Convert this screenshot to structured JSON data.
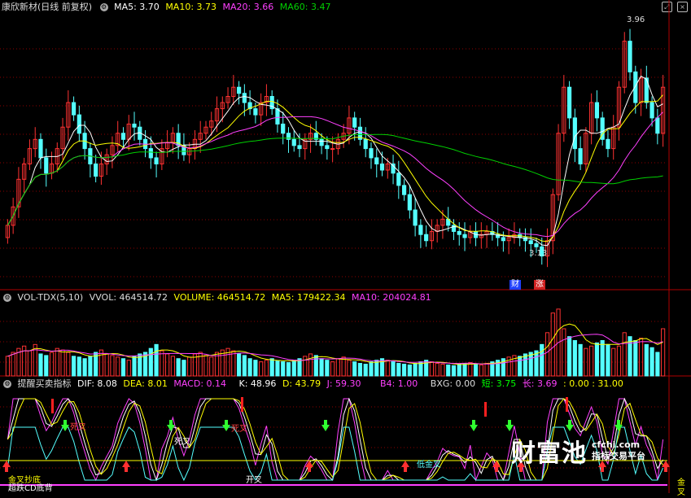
{
  "main_header": {
    "title": "康欣新材(日线 前复权)",
    "ma5": "MA5: 3.70",
    "ma10": "MA10: 3.73",
    "ma20": "MA20: 3.66",
    "ma60": "MA60: 3.47"
  },
  "price_labels": {
    "high": "3.96",
    "low": "3.13",
    "tag_cai": "财",
    "tag_zhang": "涨"
  },
  "vol_header": {
    "name": "VOL-TDX(5,10)",
    "vvol": "VVOL: 464514.72",
    "volume": "VOLUME: 464514.72",
    "ma5": "MA5: 179422.34",
    "ma10": "MA10: 204024.81"
  },
  "ind_header": {
    "name": "提醒买卖指标",
    "dif": "DIF: 8.08",
    "dea": "DEA: 8.01",
    "macd": "MACD: 0.14",
    "k": "K: 48.96",
    "d": "D: 43.79",
    "j": "J: 59.30",
    "b4": "B4: 1.00",
    "bxg": "BXG: 0.00",
    "duan": "短: 3.75",
    "chang": "长: 3.69",
    "extra": ": 0.00 : 31.00"
  },
  "ind_labels": {
    "sicha": "死叉",
    "sicha2": "死叉",
    "sicha3": "死叉",
    "jincha": "金叉",
    "dijincha": "低金叉",
    "jinlingdi": "金叉抄底",
    "chaodi": "超跌CD底背",
    "kaicha": "开叉"
  },
  "watermark": {
    "big": "财富池",
    "site": "cfchi.com",
    "slogan": "指标交易平台"
  },
  "colors": {
    "up": "#ff3232",
    "down": "#54ffff",
    "ma5": "#ffffff",
    "ma10": "#ffff00",
    "ma20": "#ff40ff",
    "ma60": "#00d000",
    "grid": "#8b0000"
  },
  "chart_data": {
    "type": "candlestick",
    "ylim": [
      3.13,
      3.96
    ],
    "closes": [
      3.3,
      3.36,
      3.45,
      3.5,
      3.55,
      3.58,
      3.52,
      3.47,
      3.5,
      3.55,
      3.62,
      3.7,
      3.66,
      3.6,
      3.55,
      3.5,
      3.46,
      3.5,
      3.53,
      3.56,
      3.6,
      3.58,
      3.63,
      3.62,
      3.58,
      3.55,
      3.52,
      3.5,
      3.55,
      3.57,
      3.6,
      3.56,
      3.53,
      3.55,
      3.58,
      3.6,
      3.62,
      3.64,
      3.68,
      3.7,
      3.72,
      3.75,
      3.73,
      3.7,
      3.68,
      3.66,
      3.7,
      3.72,
      3.68,
      3.63,
      3.6,
      3.58,
      3.56,
      3.55,
      3.58,
      3.6,
      3.58,
      3.56,
      3.55,
      3.55,
      3.58,
      3.6,
      3.65,
      3.62,
      3.58,
      3.55,
      3.52,
      3.5,
      3.48,
      3.5,
      3.47,
      3.43,
      3.4,
      3.35,
      3.3,
      3.27,
      3.25,
      3.28,
      3.3,
      3.32,
      3.3,
      3.28,
      3.27,
      3.26,
      3.28,
      3.26,
      3.27,
      3.28,
      3.27,
      3.26,
      3.25,
      3.26,
      3.27,
      3.26,
      3.25,
      3.24,
      3.23,
      3.2,
      3.25,
      3.4,
      3.6,
      3.75,
      3.65,
      3.55,
      3.5,
      3.6,
      3.7,
      3.65,
      3.58,
      3.55,
      3.62,
      3.75,
      3.9,
      3.8,
      3.7,
      3.78,
      3.7,
      3.65,
      3.6,
      3.75
    ],
    "volumes": [
      25,
      30,
      35,
      38,
      32,
      40,
      28,
      26,
      30,
      35,
      33,
      30,
      25,
      24,
      22,
      25,
      30,
      33,
      28,
      26,
      24,
      22,
      20,
      25,
      28,
      30,
      35,
      40,
      32,
      28,
      25,
      22,
      20,
      24,
      28,
      30,
      26,
      24,
      30,
      33,
      35,
      32,
      28,
      26,
      22,
      20,
      18,
      20,
      22,
      19,
      18,
      17,
      20,
      22,
      25,
      28,
      26,
      22,
      20,
      18,
      22,
      24,
      20,
      18,
      16,
      15,
      18,
      20,
      22,
      20,
      18,
      16,
      15,
      14,
      16,
      18,
      20,
      18,
      16,
      15,
      14,
      13,
      15,
      16,
      17,
      15,
      14,
      16,
      18,
      20,
      22,
      24,
      26,
      25,
      28,
      30,
      32,
      40,
      55,
      80,
      85,
      60,
      50,
      45,
      40,
      35,
      38,
      42,
      45,
      40,
      35,
      38,
      55,
      50,
      45,
      48,
      40,
      36,
      30,
      60
    ],
    "vol_ylim": [
      0,
      90
    ]
  }
}
